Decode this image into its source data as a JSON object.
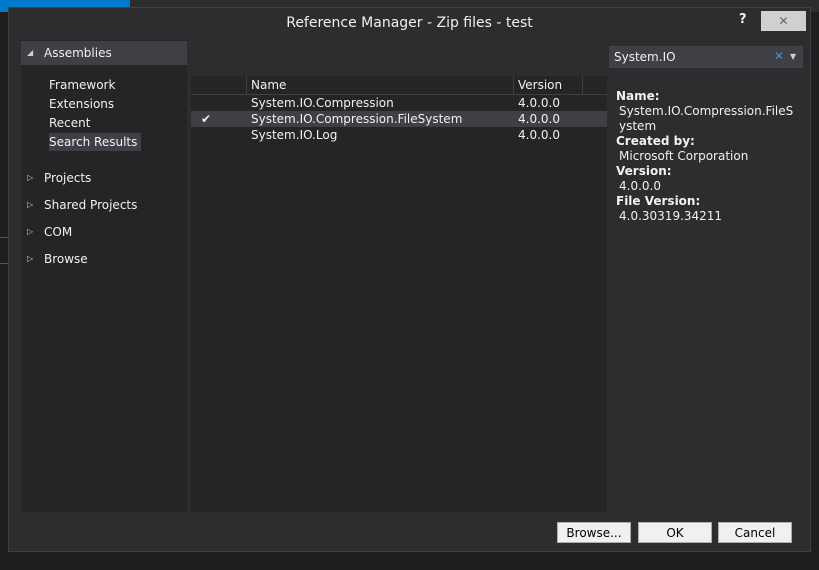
{
  "dialog": {
    "title": "Reference Manager - Zip files - test",
    "help": "?",
    "close": "✕"
  },
  "nav": {
    "categories": [
      {
        "label": "Assemblies",
        "expanded": true
      },
      {
        "label": "Projects",
        "expanded": false
      },
      {
        "label": "Shared Projects",
        "expanded": false
      },
      {
        "label": "COM",
        "expanded": false
      },
      {
        "label": "Browse",
        "expanded": false
      }
    ],
    "assemblies_sub": [
      "Framework",
      "Extensions",
      "Recent",
      "Search Results"
    ],
    "selected_sub": "Search Results"
  },
  "list": {
    "headers": {
      "name": "Name",
      "version": "Version"
    },
    "rows": [
      {
        "name": "System.IO.Compression",
        "version": "4.0.0.0",
        "checked": false
      },
      {
        "name": "System.IO.Compression.FileSystem",
        "version": "4.0.0.0",
        "checked": true
      },
      {
        "name": "System.IO.Log",
        "version": "4.0.0.0",
        "checked": false
      }
    ]
  },
  "search": {
    "value": "System.IO"
  },
  "details": {
    "name_label": "Name:",
    "name_value": "System.IO.Compression.FileSystem",
    "created_label": "Created by:",
    "created_value": "Microsoft Corporation",
    "version_label": "Version:",
    "version_value": "4.0.0.0",
    "file_version_label": "File Version:",
    "file_version_value": "4.0.30319.34211"
  },
  "buttons": {
    "browse": "Browse...",
    "ok": "OK",
    "cancel": "Cancel"
  },
  "colors": {
    "accent": "#007acc",
    "clear_icon": "#3a96dd"
  }
}
